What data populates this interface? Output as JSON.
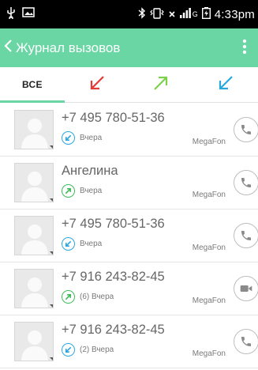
{
  "status_bar": {
    "time": "4:33pm",
    "sim_label": "G"
  },
  "app_bar": {
    "title": "Журнал вызовов"
  },
  "tabs": [
    {
      "label": "ВСЕ",
      "icon": "all-calls",
      "active": true
    },
    {
      "label": "",
      "icon": "missed-call-arrow-icon",
      "color": "#e53935"
    },
    {
      "label": "",
      "icon": "outgoing-call-arrow-icon",
      "color": "#7ed04b"
    },
    {
      "label": "",
      "icon": "incoming-call-arrow-icon",
      "color": "#29a8e0"
    }
  ],
  "colors": {
    "accent": "#69d6a4",
    "incoming": "#29a8e0",
    "outgoing": "#3dbb5a",
    "missed": "#e53935"
  },
  "calls": [
    {
      "name": "+7 495 780-51-36",
      "type": "incoming",
      "time": "Вчера",
      "carrier": "MegaFon",
      "action": "call-icon"
    },
    {
      "name": "Ангелина",
      "type": "outgoing",
      "time": "Вчера",
      "carrier": "MegaFon",
      "action": "call-icon"
    },
    {
      "name": "+7 495 780-51-36",
      "type": "incoming",
      "time": "Вчера",
      "carrier": "MegaFon",
      "action": "call-icon"
    },
    {
      "name": "+7 916 243-82-45",
      "type": "outgoing",
      "time": "(6) Вчера",
      "carrier": "MegaFon",
      "action": "video-call-icon"
    },
    {
      "name": "+7 916 243-82-45",
      "type": "incoming",
      "time": "(2) Вчера",
      "carrier": "MegaFon",
      "action": "call-icon"
    }
  ]
}
